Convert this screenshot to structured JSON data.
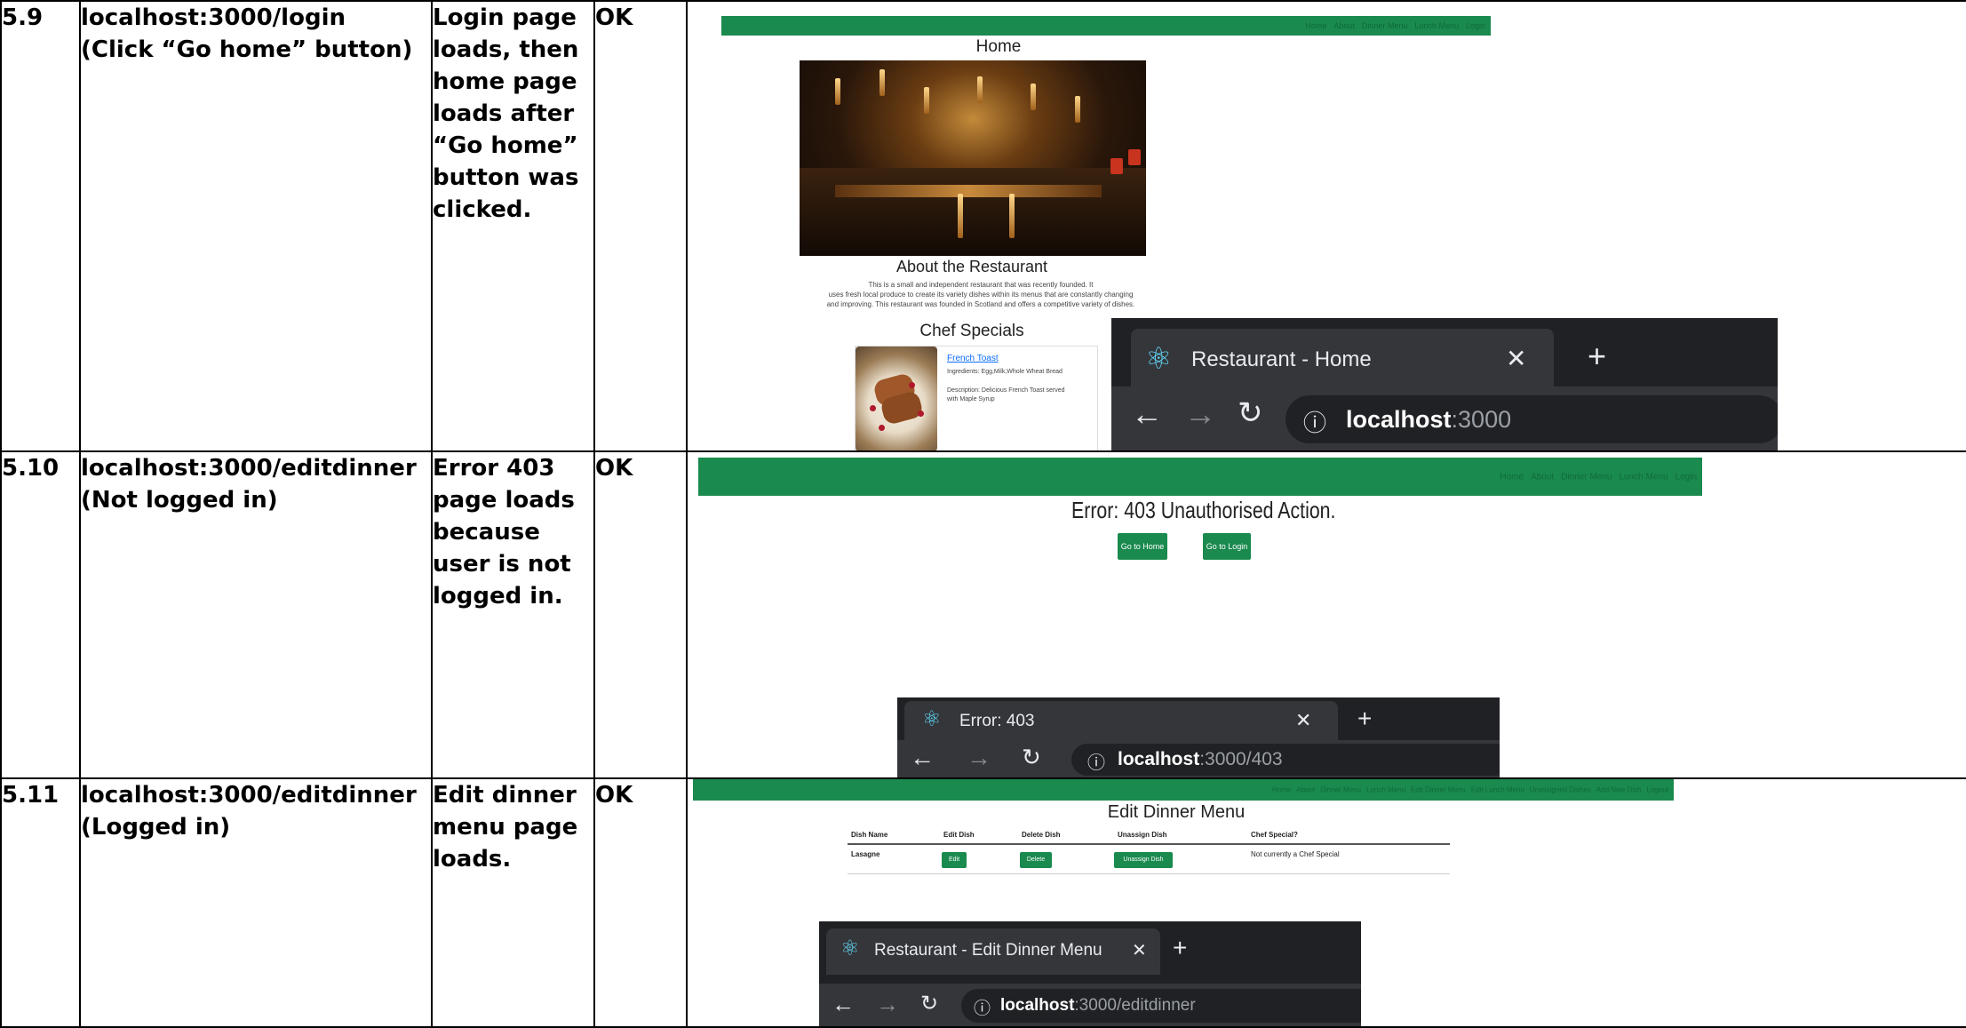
{
  "rows": [
    {
      "id": "5.9",
      "url": "localhost:3000/login",
      "note": "(Click “Go home” button)",
      "expected": "Login page loads, then home page loads after “Go home” button was clicked.",
      "result": "OK",
      "screenshot": {
        "nav_links": [
          "Home",
          "About",
          "Dinner Menu",
          "Lunch Menu",
          "Login"
        ],
        "home_heading": "Home",
        "about_heading": "About the Restaurant",
        "about_lines": [
          "This is a small and independent restaurant that was recently founded. It",
          "uses fresh local produce to create its variety dishes within its menus that are constantly changing",
          "and improving. This restaurant was founded in Scotland and offers a competitive variety of dishes."
        ],
        "specials_heading": "Chef Specials",
        "dish_name": "French Toast",
        "dish_ingredients": "Ingredients: Egg,Milk,Whole Wheat Bread",
        "dish_description_1": "Description: Delicious French Toast served",
        "dish_description_2": "with Maple Syrup",
        "browser_tab_title": "Restaurant - Home",
        "browser_url_host": "localhost",
        "browser_url_rest": ":3000"
      }
    },
    {
      "id": "5.10",
      "url": "localhost:3000/editdinner",
      "note": "(Not logged in)",
      "expected": "Error 403 page loads because user is not logged in.",
      "result": "OK",
      "screenshot": {
        "nav_links": [
          "Home",
          "About",
          "Dinner Menu",
          "Lunch Menu",
          "Login"
        ],
        "error_title": "Error: 403 Unauthorised Action.",
        "btn_home": "Go to Home",
        "btn_login": "Go to Login",
        "browser_tab_title": "Error: 403",
        "browser_url_host": "localhost",
        "browser_url_rest": ":3000/403"
      }
    },
    {
      "id": "5.11",
      "url": "localhost:3000/editdinner",
      "note": "(Logged in)",
      "expected": "Edit dinner menu page loads.",
      "result": "OK",
      "screenshot": {
        "nav_links": [
          "Home",
          "About",
          "Dinner Menu",
          "Lunch Menu",
          "Edit Dinner Menu",
          "Edit Lunch Menu",
          "Unassigned Dishes",
          "Add New Dish",
          "Logout"
        ],
        "page_heading": "Edit Dinner Menu",
        "table_headers": [
          "Dish Name",
          "Edit Dish",
          "Delete Dish",
          "Unassign Dish",
          "Chef Special?"
        ],
        "row_dish": "Lasagne",
        "btn_edit": "Edit",
        "btn_delete": "Delete",
        "btn_unassign": "Unassign Dish",
        "chef_special_status": "Not currently a Chef Special",
        "browser_tab_title": "Restaurant - Edit Dinner Menu",
        "browser_url_host": "localhost",
        "browser_url_rest": ":3000/editdinner"
      }
    }
  ],
  "colors": {
    "nav_green": "#1a8a4e",
    "chrome_dark": "#202124",
    "chrome_tab": "#35363a",
    "react_icon": "#61dafb"
  }
}
